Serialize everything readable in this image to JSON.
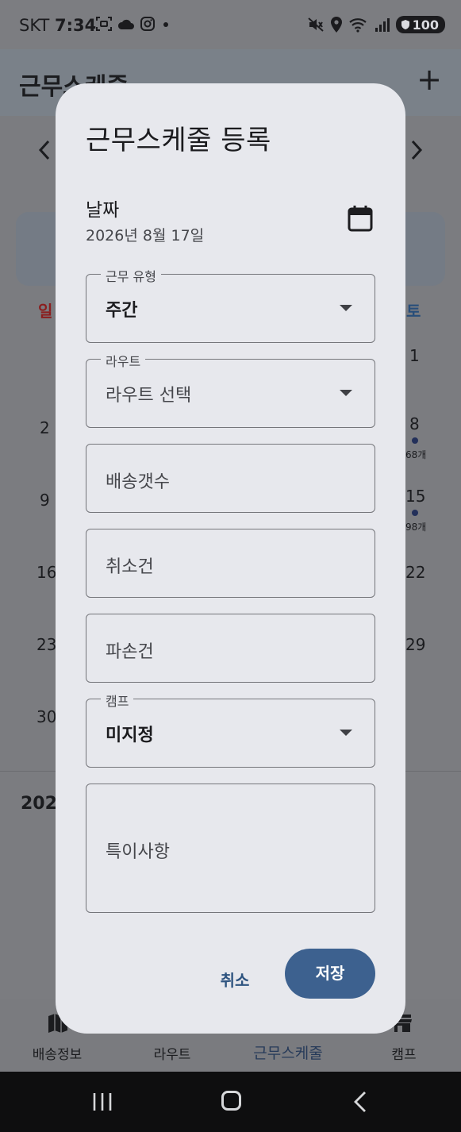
{
  "status_bar": {
    "carrier": "SKT",
    "time": "7:34",
    "battery": "100",
    "icons": [
      "screenshot-icon",
      "cloud-icon",
      "instagram-icon",
      "dot-icon",
      "mute-icon",
      "location-icon",
      "wifi-icon",
      "signal-icon",
      "battery-icon"
    ]
  },
  "background": {
    "app_title": "근무스케줄",
    "add_label": "+",
    "weekday_sun": "일",
    "weekday_sat": "토",
    "left_days": [
      "2",
      "9",
      "16",
      "23",
      "30"
    ],
    "right_days": [
      "1",
      "8",
      "15",
      "22",
      "29"
    ],
    "counts": [
      "68개",
      "98개"
    ],
    "section_year": "202"
  },
  "bottom_nav": {
    "items": [
      {
        "label": "배송정보",
        "icon": "map-icon"
      },
      {
        "label": "라우트",
        "icon": "route-icon"
      },
      {
        "label": "근무스케줄",
        "icon": "calendar-icon"
      },
      {
        "label": "캠프",
        "icon": "store-icon"
      }
    ],
    "active_index": 2
  },
  "dialog": {
    "title": "근무스케줄 등록",
    "date_label": "날짜",
    "date_value": "2026년 8월 17일",
    "work_type": {
      "label": "근무 유형",
      "value": "주간"
    },
    "route": {
      "label": "라우트",
      "value": "라우트 선택"
    },
    "delivery_count": {
      "placeholder": "배송갯수"
    },
    "cancel_count": {
      "placeholder": "취소건"
    },
    "damage_count": {
      "placeholder": "파손건"
    },
    "camp": {
      "label": "캠프",
      "value": "미지정"
    },
    "notes": {
      "placeholder": "특이사항"
    },
    "cancel_button": "취소",
    "save_button": "저장"
  },
  "colors": {
    "dialog_bg": "#e7e8ed",
    "primary": "#3d618f",
    "scrim": "#7b7c80"
  }
}
